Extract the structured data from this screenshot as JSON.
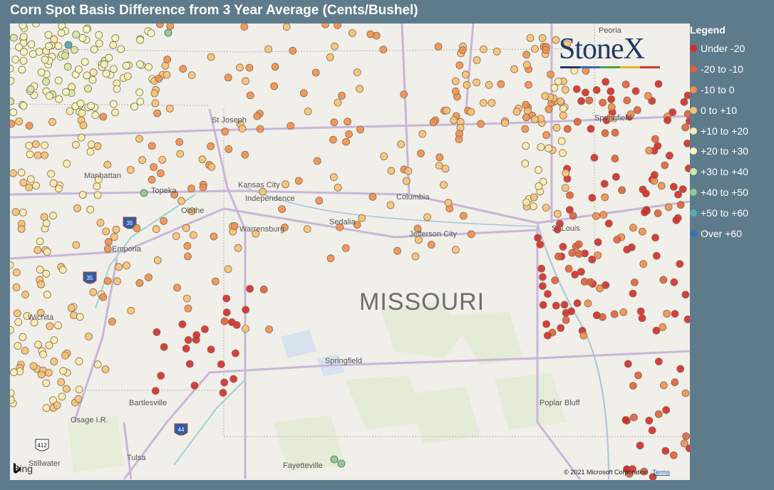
{
  "title": "Corn Spot Basis Difference from 3 Year Average (Cents/Bushel)",
  "legend": {
    "title": "Legend",
    "items": [
      {
        "label": "Under -20",
        "color": "#d42a2a"
      },
      {
        "label": "-20 to -10",
        "color": "#e05f3c"
      },
      {
        "label": "-10 to 0",
        "color": "#ef8f4c"
      },
      {
        "label": "0 to +10",
        "color": "#f6c174"
      },
      {
        "label": "+10 to +20",
        "color": "#f8ebac"
      },
      {
        "label": "+20 to +30",
        "color": "#f1f7c0"
      },
      {
        "label": "+30 to +40",
        "color": "#cfe8a6"
      },
      {
        "label": "+40 to +50",
        "color": "#8fcb93"
      },
      {
        "label": "+50 to +60",
        "color": "#5aaeb3"
      },
      {
        "label": "Over +60",
        "color": "#2f74b8"
      }
    ]
  },
  "map": {
    "state_label": "MISSOURI",
    "places": [
      "Peoria",
      "Springfield",
      "St Joseph",
      "Manhattan",
      "Topeka",
      "Kansas City",
      "Independence",
      "Olathe",
      "Columbia",
      "Sedalia",
      "Warrensburg",
      "Jefferson City",
      "St Louis",
      "Emporia",
      "Wichita",
      "Springfield",
      "Bartlesville",
      "Osage I.R.",
      "Poplar Bluff",
      "Tulsa",
      "Stillwater",
      "Fayetteville"
    ],
    "highway_shields": [
      "35",
      "35",
      "44",
      "412"
    ],
    "attribution": {
      "provider": "Bing",
      "copyright": "© 2021 Microsoft Corporation",
      "terms": "Terms"
    }
  },
  "logo": {
    "text": "StoneX"
  }
}
